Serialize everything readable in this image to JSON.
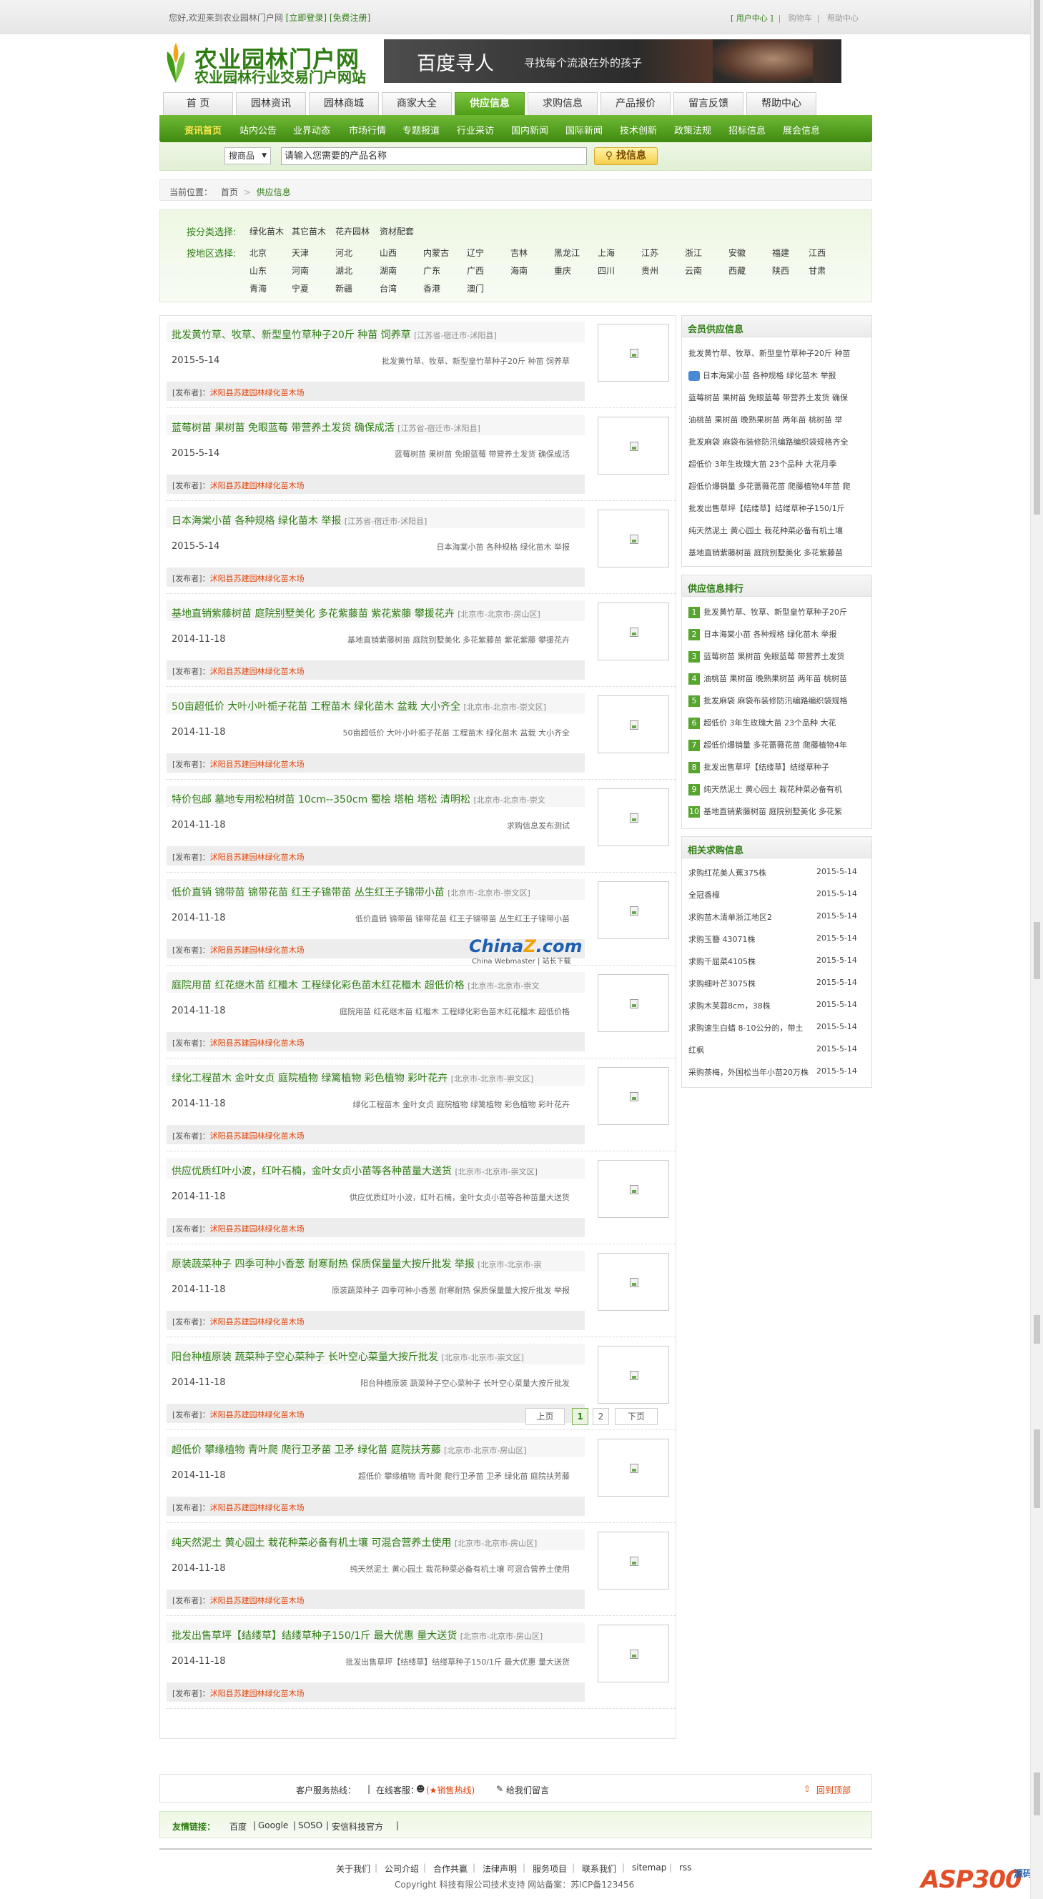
{
  "topbar": {
    "welcome": "您好,欢迎来到农业园林门户网",
    "login": "[立即登录]",
    "register": "[免费注册]",
    "user_center": "[ 用户中心 ]",
    "cart": "购物车",
    "help": "帮助中心"
  },
  "logo": {
    "title": "农业园林门户网",
    "subtitle": "农业园林行业交易门户网站"
  },
  "banner": {
    "big": "百度寻人",
    "small": "寻找每个流浪在外的孩子"
  },
  "nav_tabs": [
    "首 页",
    "园林资讯",
    "园林商城",
    "商家大全",
    "供应信息",
    "求购信息",
    "产品报价",
    "留言反馈",
    "帮助中心"
  ],
  "sub_nav": [
    "资讯首页",
    "站内公告",
    "业界动态",
    "市场行情",
    "专题报道",
    "行业采访",
    "国内新闻",
    "国际新闻",
    "技术创新",
    "政策法规",
    "招标信息",
    "展会信息"
  ],
  "search": {
    "type": "搜商品",
    "placeholder": "请输入您需要的产品名称",
    "button": "找信息"
  },
  "breadcrumb": {
    "label": "当前位置：",
    "home": "首页",
    "current": "供应信息"
  },
  "filter": {
    "cat_label": "按分类选择:",
    "categories": [
      "绿化苗木",
      "其它苗木",
      "花卉园林",
      "资材配套"
    ],
    "area_label": "按地区选择:",
    "areas": [
      [
        "北京",
        "天津",
        "河北",
        "山西",
        "内蒙古",
        "辽宁",
        "吉林",
        "黑龙江",
        "上海",
        "江苏",
        "浙江",
        "安徽",
        "福建",
        "江西"
      ],
      [
        "山东",
        "河南",
        "湖北",
        "湖南",
        "广东",
        "广西",
        "海南",
        "重庆",
        "四川",
        "贵州",
        "云南",
        "西藏",
        "陕西",
        "甘肃"
      ],
      [
        "青海",
        "宁夏",
        "新疆",
        "台湾",
        "香港",
        "澳门"
      ]
    ]
  },
  "list": [
    {
      "title": "批发黄竹草、牧草、新型皇竹草种子20斤 种苗 饲养草",
      "loc": "[江苏省-宿迁市-沭阳县]",
      "date": "2015-5-14",
      "desc": "批发黄竹草、牧草、新型皇竹草种子20斤 种苗 饲养草",
      "pub_label": "[发布者]：",
      "company": "沭阳县苏建园林绿化苗木场"
    },
    {
      "title": "蓝莓树苗 果树苗 免眼蓝莓 带营养土发货 确保成活",
      "loc": "[江苏省-宿迁市-沭阳县]",
      "date": "2015-5-14",
      "desc": "蓝莓树苗 果树苗 免眼蓝莓 带营养土发货 确保成活",
      "pub_label": "[发布者]：",
      "company": "沭阳县苏建园林绿化苗木场"
    },
    {
      "title": "日本海棠小苗 各种规格 绿化苗木 举报",
      "loc": "[江苏省-宿迁市-沭阳县]",
      "date": "2015-5-14",
      "desc": "日本海棠小苗 各种规格 绿化苗木 举报",
      "pub_label": "[发布者]：",
      "company": "沭阳县苏建园林绿化苗木场"
    },
    {
      "title": "基地直销紫藤树苗 庭院别墅美化 多花紫藤苗 紫花紫藤 攀援花卉",
      "loc": "[北京市-北京市-房山区]",
      "date": "2014-11-18",
      "desc": "基地直销紫藤树苗 庭院别墅美化 多花紫藤苗 紫花紫藤 攀援花卉",
      "pub_label": "[发布者]：",
      "company": "沭阳县苏建园林绿化苗木场"
    },
    {
      "title": "50亩超低价 大叶小叶栀子花苗 工程苗木 绿化苗木 盆栽 大小齐全",
      "loc": "[北京市-北京市-崇文区]",
      "date": "2014-11-18",
      "desc": "50亩超低价 大叶小叶栀子花苗 工程苗木 绿化苗木 盆栽 大小齐全",
      "pub_label": "[发布者]：",
      "company": "沭阳县苏建园林绿化苗木场"
    },
    {
      "title": "特价包邮 墓地专用松柏树苗 10cm--350cm 蜀桧 塔柏 塔松 清明松",
      "loc": "[北京市-北京市-崇文",
      "date": "2014-11-18",
      "desc": "求购信息发布测试",
      "pub_label": "[发布者]：",
      "company": "沭阳县苏建园林绿化苗木场"
    },
    {
      "title": "低价直销 锦带苗 锦带花苗 红王子锦带苗 丛生红王子锦带小苗",
      "loc": "[北京市-北京市-崇文区]",
      "date": "2014-11-18",
      "desc": "低价直销 锦带苗 锦带花苗 红王子锦带苗 丛生红王子锦带小苗",
      "pub_label": "[发布者]：",
      "company": "沭阳县苏建园林绿化苗木场"
    },
    {
      "title": "庭院用苗 红花继木苗 红檵木 工程绿化彩色苗木红花檵木 超低价格",
      "loc": "[北京市-北京市-崇文",
      "date": "2014-11-18",
      "desc": "庭院用苗 红花继木苗 红檵木 工程绿化彩色苗木红花檵木 超低价格",
      "pub_label": "[发布者]：",
      "company": "沭阳县苏建园林绿化苗木场"
    },
    {
      "title": "绿化工程苗木 金叶女贞 庭院植物 绿篱植物 彩色植物 彩叶花卉",
      "loc": "[北京市-北京市-崇文区]",
      "date": "2014-11-18",
      "desc": "绿化工程苗木 金叶女贞 庭院植物 绿篱植物 彩色植物 彩叶花卉",
      "pub_label": "[发布者]：",
      "company": "沭阳县苏建园林绿化苗木场"
    },
    {
      "title": "供应优质红叶小波，红叶石楠，金叶女贞小苗等各种苗量大送货",
      "loc": "[北京市-北京市-崇文区]",
      "date": "2014-11-18",
      "desc": "供应优质红叶小波，红叶石楠，金叶女贞小苗等各种苗量大送货",
      "pub_label": "[发布者]：",
      "company": "沭阳县苏建园林绿化苗木场"
    },
    {
      "title": "原装蔬菜种子 四季可种小香葱 耐寒耐热 保质保量量大按斤批发 举报",
      "loc": "[北京市-北京市-崇",
      "date": "2014-11-18",
      "desc": "原装蔬菜种子 四季可种小香葱 耐寒耐热 保质保量量大按斤批发 举报",
      "pub_label": "[发布者]：",
      "company": "沭阳县苏建园林绿化苗木场"
    },
    {
      "title": "阳台种植原装 蔬菜种子空心菜种子 长叶空心菜量大按斤批发",
      "loc": "[北京市-北京市-崇文区]",
      "date": "2014-11-18",
      "desc": "阳台种植原装 蔬菜种子空心菜种子 长叶空心菜量大按斤批发",
      "pub_label": "[发布者]：",
      "company": "沭阳县苏建园林绿化苗木场"
    },
    {
      "title": "超低价 攀缘植物 青叶爬 爬行卫矛苗 卫矛 绿化苗 庭院扶芳藤",
      "loc": "[北京市-北京市-房山区]",
      "date": "2014-11-18",
      "desc": "超低价 攀缘植物 青叶爬 爬行卫矛苗 卫矛 绿化苗 庭院扶芳藤",
      "pub_label": "[发布者]：",
      "company": "沭阳县苏建园林绿化苗木场"
    },
    {
      "title": "纯天然泥土 黄心园土 栽花种菜必备有机土壤 可混合营养土使用",
      "loc": "[北京市-北京市-房山区]",
      "date": "2014-11-18",
      "desc": "纯天然泥土 黄心园土 栽花种菜必备有机土壤 可混合营养土使用",
      "pub_label": "[发布者]：",
      "company": "沭阳县苏建园林绿化苗木场"
    },
    {
      "title": "批发出售草坪【结缕草】结缕草种子150/1斤 最大优惠 量大送货",
      "loc": "[北京市-北京市-房山区]",
      "date": "2014-11-18",
      "desc": "批发出售草坪【结缕草】结缕草种子150/1斤 最大优惠 量大送货",
      "pub_label": "[发布者]：",
      "company": "沭阳县苏建园林绿化苗木场"
    }
  ],
  "pager": {
    "prev": "上页",
    "pages": [
      "1",
      "2"
    ],
    "next": "下页"
  },
  "member_supply": {
    "title": "会员供应信息",
    "items": [
      "批发黄竹草、牧草、新型皇竹草种子20斤 种苗",
      "日本海棠小苗 各种规格 绿化苗木 举报",
      "蓝莓树苗 果树苗 免眼蓝莓 带营养土发货 确保",
      "油桃苗 果树苗 晚熟果树苗 两年苗 桃树苗 举",
      "批发麻袋 麻袋布装修防汛编路编织袋规格齐全",
      "超低价 3年生玫瑰大苗 23个品种 大花月季",
      "超低价爆销量 多花蔷薇花苗 爬藤植物4年苗 爬",
      "批发出售草坪【结缕草】结缕草种子150/1斤",
      "纯天然泥土 黄心园土 栽花种菜必备有机土壤",
      "基地直销紫藤树苗 庭院别墅美化 多花紫藤苗"
    ]
  },
  "supply_rank": {
    "title": "供应信息排行",
    "items": [
      "批发黄竹草、牧草、新型皇竹草种子20斤",
      "日本海棠小苗 各种规格 绿化苗木 举报",
      "蓝莓树苗 果树苗 免眼蓝莓 带营养土发货",
      "油桃苗 果树苗 晚熟果树苗 两年苗 桃树苗",
      "批发麻袋 麻袋布装修防汛编路编织袋规格",
      "超低价 3年生玫瑰大苗 23个品种 大花",
      "超低价爆销量 多花蔷薇花苗 爬藤植物4年",
      "批发出售草坪【结缕草】结缕草种子",
      "纯天然泥土 黄心园土 栽花种菜必备有机",
      "基地直销紫藤树苗 庭院别墅美化 多花紫"
    ]
  },
  "related_buy": {
    "title": "相关求购信息",
    "items": [
      {
        "t": "求购红花美人蕉375株",
        "d": "2015-5-14"
      },
      {
        "t": "全冠香樟",
        "d": "2015-5-14"
      },
      {
        "t": "求购苗木清单浙江地区2",
        "d": "2015-5-14"
      },
      {
        "t": "求购玉簪 43071株",
        "d": "2015-5-14"
      },
      {
        "t": "求购千屈菜4105株",
        "d": "2015-5-14"
      },
      {
        "t": "求购细叶芒3075株",
        "d": "2015-5-14"
      },
      {
        "t": "求购木芙蓉8cm，38株",
        "d": "2015-5-14"
      },
      {
        "t": "求购速生白蜡 8-10公分的，带土",
        "d": "2015-5-14"
      },
      {
        "t": "红枫",
        "d": "2015-5-14"
      },
      {
        "t": "采购茶梅，外国松当年小苗20万株",
        "d": "2015-5-14"
      }
    ]
  },
  "contact": {
    "hotline": "客户服务热线：",
    "online": "在线客服：",
    "sales": "(★销售热线)",
    "message": "给我们留言",
    "top": "回到顶部"
  },
  "friend": {
    "label": "友情链接：",
    "links": [
      "百度",
      "Google",
      "SOSO",
      "安信科技官方"
    ]
  },
  "footer": {
    "links": [
      "关于我们",
      "公司介绍",
      "合作共赢",
      "法律声明",
      "服务项目",
      "联系我们",
      "sitemap",
      "rss"
    ],
    "copyright": "Copyright  科技有限公司技术支持  网站备案：苏ICP备123456"
  },
  "watermarks": {
    "china": "China",
    "z": "Z",
    "com": ".com",
    "china_sub": "China Webmaster | 站长下载",
    "asp": "ASP300",
    "asp_cn": "源码"
  }
}
